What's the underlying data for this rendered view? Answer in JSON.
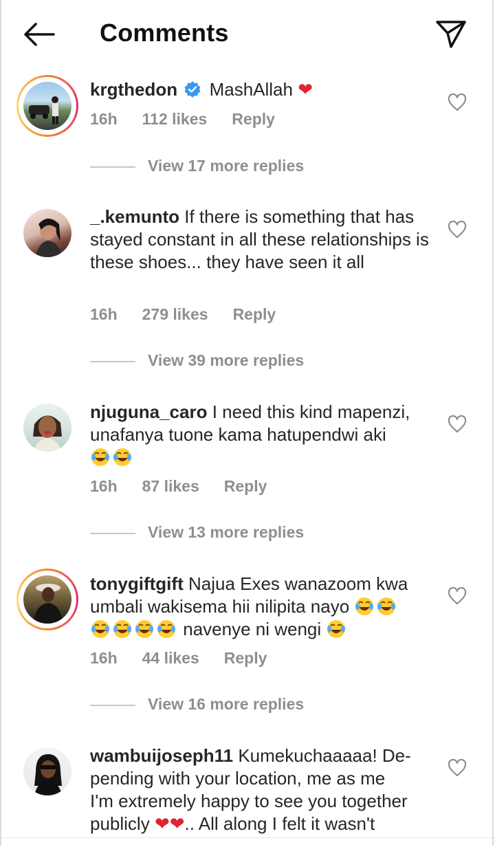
{
  "header": {
    "title": "Comments",
    "back_icon": "arrow-left-icon",
    "send_icon": "paper-plane-icon"
  },
  "colors": {
    "text": "#262626",
    "meta": "#8e8e8e",
    "verified": "#3897f0",
    "heart": "#e0242f"
  },
  "comments": [
    {
      "username": "krgthedon",
      "verified": true,
      "text": "MashAllah",
      "suffix_emoji": "❤️",
      "time": "16h",
      "likes": "112 likes",
      "reply": "Reply",
      "view_replies": "View 17 more replies"
    },
    {
      "username": "_.kemunto",
      "text": "If there is something that has stayed constant in all these relationships is these shoes... they have seen it all",
      "time": "16h",
      "likes": "279 likes",
      "reply": "Reply",
      "view_replies": "View 39 more replies"
    },
    {
      "username": "njuguna_caro",
      "text": "I need this kind mapenzi, unafanya tuone kama hatupendwi aki",
      "emoji_count": 2,
      "time": "16h",
      "likes": "87 likes",
      "reply": "Reply",
      "view_replies": "View 13 more replies"
    },
    {
      "username": "tonygiftgift",
      "text": "Najua Exes wanazoom kwa umbali wakisema hii nilipita nayo",
      "text_after_emojis": "navenye ni wengi",
      "time": "16h",
      "likes": "44 likes",
      "reply": "Reply",
      "view_replies": "View 16 more replies"
    },
    {
      "username": "wambuijoseph11",
      "text_line1": "Kumekuchaaaaa! De-",
      "text_line2": "pending with your location, me as me",
      "text_line3": "I'm extremely happy to see you together",
      "text_line4_a": "publicly",
      "text_line4_b": ".. All along I felt it wasn't"
    }
  ]
}
